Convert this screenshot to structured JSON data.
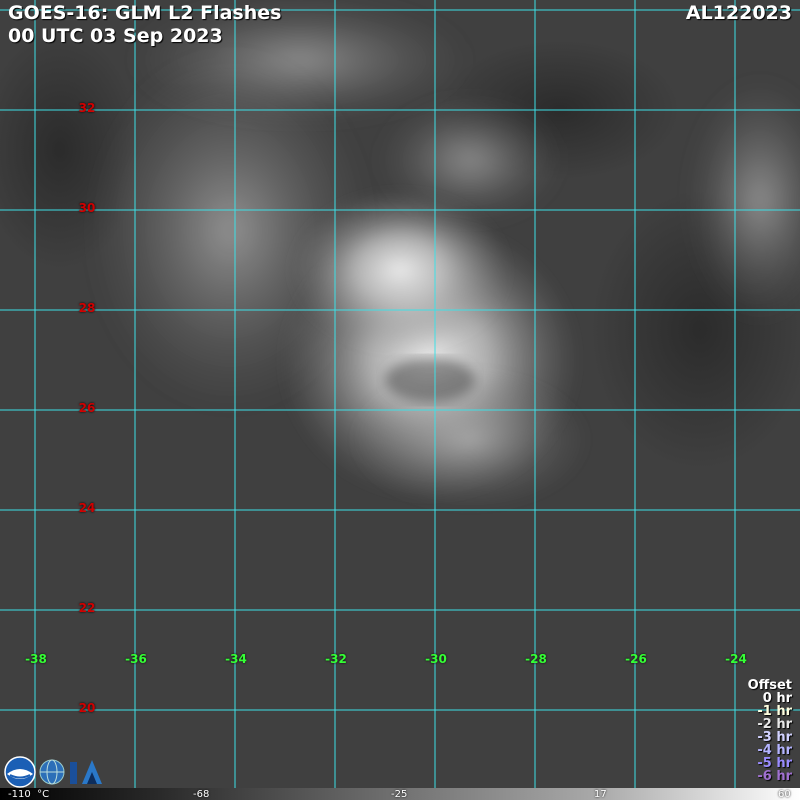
{
  "header": {
    "title_line1": "GOES-16: GLM L2 Flashes",
    "title_line2": "00 UTC 03 Sep 2023",
    "storm_id": "AL122023"
  },
  "map": {
    "grid_color": "#3de0e6",
    "latitude_labels": [
      "32",
      "30",
      "28",
      "26",
      "24",
      "22",
      "20"
    ],
    "longitude_labels": [
      "-38",
      "-36",
      "-34",
      "-32",
      "-30",
      "-28",
      "-26",
      "-24"
    ],
    "latitude_label_color": "#d10000",
    "longitude_label_color": "#35ff35"
  },
  "legend": {
    "title": "Offset",
    "entries": [
      {
        "label": "0 hr",
        "color": "#ffffff"
      },
      {
        "label": "-1 hr",
        "color": "#ffffe0"
      },
      {
        "label": "-2 hr",
        "color": "#e8e8e8"
      },
      {
        "label": "-3 hr",
        "color": "#d2d2ff"
      },
      {
        "label": "-4 hr",
        "color": "#b4b4ff"
      },
      {
        "label": "-5 hr",
        "color": "#9a8cff"
      },
      {
        "label": "-6 hr",
        "color": "#a070d0"
      }
    ]
  },
  "colorbar": {
    "ticks": [
      "-110",
      "-68",
      "-25",
      "17",
      "60"
    ],
    "unit": "°C"
  },
  "logos": [
    "noaa-logo",
    "cira-logo"
  ]
}
